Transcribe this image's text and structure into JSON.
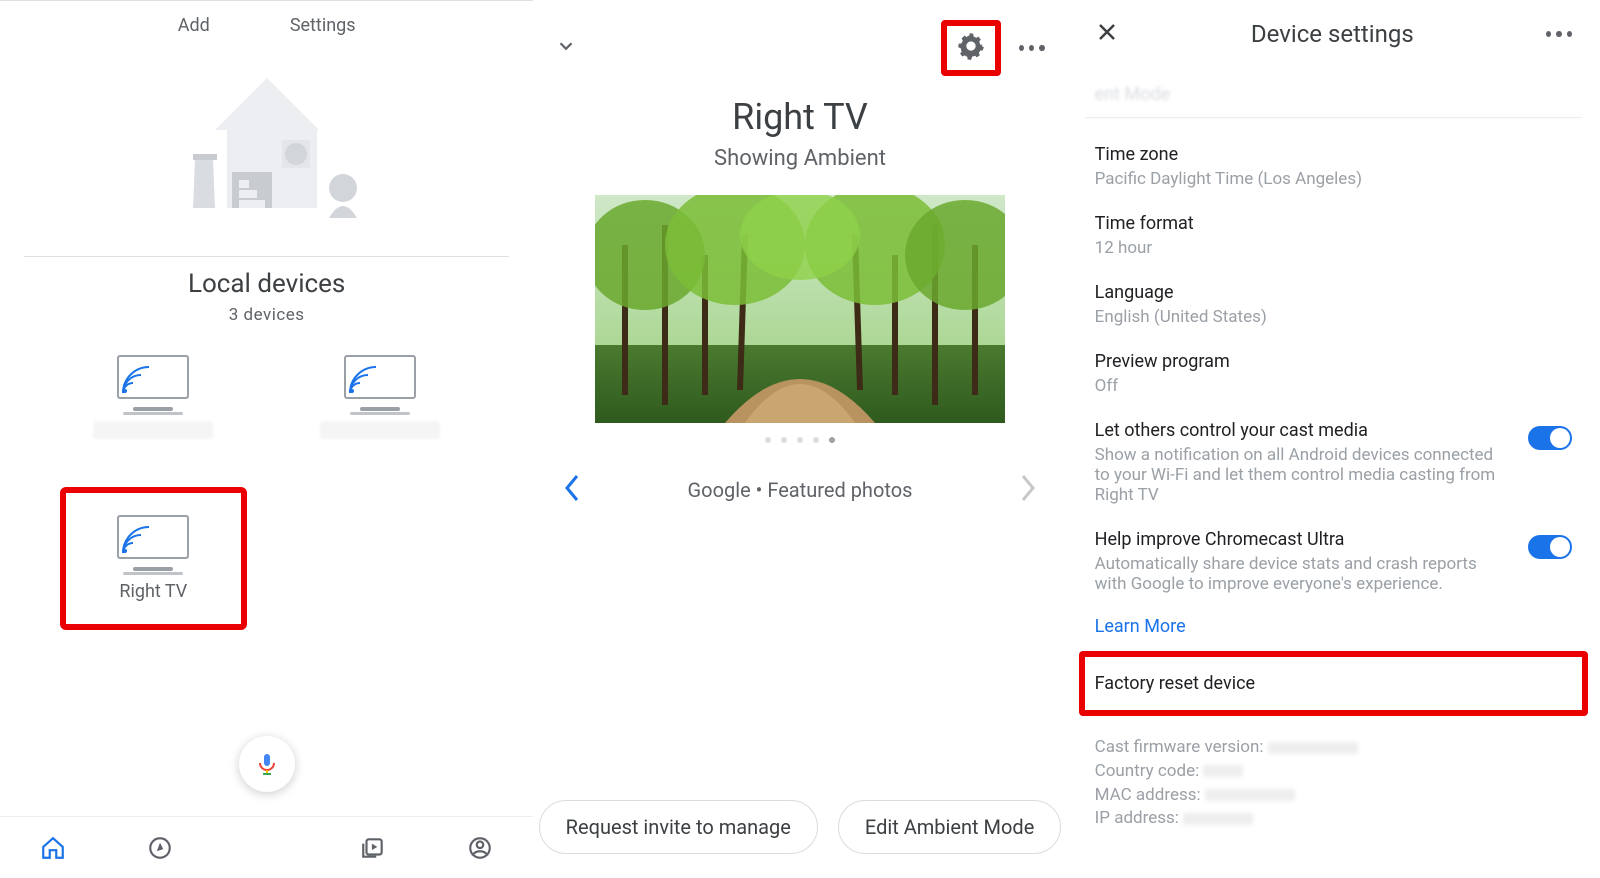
{
  "panel1": {
    "tabs": {
      "add": "Add",
      "settings": "Settings"
    },
    "local": {
      "heading": "Local devices",
      "count": "3 devices"
    },
    "devices": {
      "rightTv": "Right TV"
    },
    "bottomNav": {
      "home": "home-icon",
      "explore": "explore-icon",
      "media": "media-icon",
      "account": "account-icon"
    }
  },
  "panel2": {
    "title": "Right TV",
    "subtitle": "Showing Ambient",
    "caption": "Google • Featured photos",
    "buttons": {
      "request": "Request invite to manage",
      "edit": "Edit Ambient Mode"
    }
  },
  "panel3": {
    "header": "Device settings",
    "ghost": {
      "label": "ent Mode"
    },
    "timezone": {
      "title": "Time zone",
      "value": "Pacific Daylight Time (Los Angeles)"
    },
    "timeformat": {
      "title": "Time format",
      "value": "12 hour"
    },
    "language": {
      "title": "Language",
      "value": "English (United States)"
    },
    "preview": {
      "title": "Preview program",
      "value": "Off"
    },
    "castControl": {
      "title": "Let others control your cast media",
      "value": "Show a notification on all Android devices connected to your Wi-Fi and let them control media casting from Right TV"
    },
    "helpImprove": {
      "title": "Help improve Chromecast Ultra",
      "value": "Automatically share device stats and crash reports with Google to improve everyone's experience."
    },
    "learnMore": "Learn More",
    "factoryReset": "Factory reset device",
    "meta": {
      "firmware": "Cast firmware version:",
      "country": "Country code:",
      "mac": "MAC address:",
      "ip": "IP address:"
    }
  }
}
